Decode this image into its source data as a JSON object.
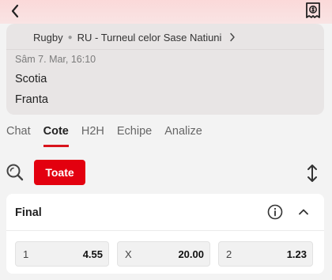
{
  "header": {
    "back_icon": "chevron-left-icon",
    "bets_icon": "coin-receipt-icon"
  },
  "match": {
    "sport": "Rugby",
    "league": "RU - Turneul celor Sase Natiuni",
    "date": "Sâm 7. Mar, 16:10",
    "home_team": "Scotia",
    "away_team": "Franta"
  },
  "tabs": [
    {
      "label": "Chat",
      "active": false
    },
    {
      "label": "Cote",
      "active": true
    },
    {
      "label": "H2H",
      "active": false
    },
    {
      "label": "Echipe",
      "active": false
    },
    {
      "label": "Analize",
      "active": false
    }
  ],
  "filters": {
    "selected": "Toate",
    "accent": "#e3000f"
  },
  "market": {
    "title": "Final",
    "odds": [
      {
        "label": "1",
        "value": "4.55"
      },
      {
        "label": "X",
        "value": "20.00"
      },
      {
        "label": "2",
        "value": "1.23"
      }
    ]
  },
  "colors": {
    "accent_red": "#d8141c",
    "top_bar": "#fbd9d9",
    "card_bg": "#e8e5e5"
  }
}
